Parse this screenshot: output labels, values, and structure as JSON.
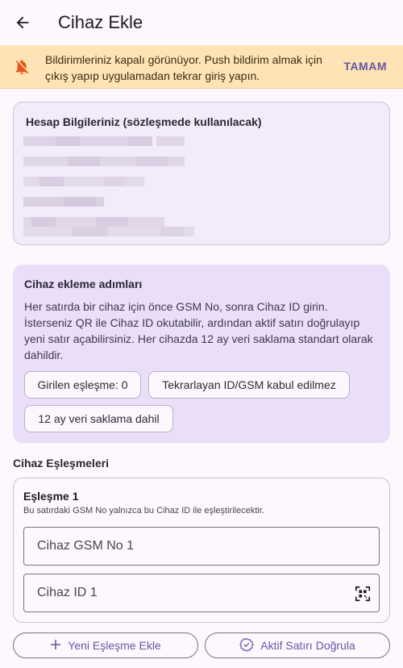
{
  "appbar": {
    "title": "Cihaz Ekle",
    "back_icon": "arrow-back-icon"
  },
  "banner": {
    "icon": "notifications-off-icon",
    "text": "Bildirimleriniz kapalı görünüyor. Push bildirim almak için çıkış yapıp uygulamadan tekrar giriş yapın.",
    "action_label": "TAMAM",
    "color_bg": "#fde3b5",
    "color_icon": "#e8541a"
  },
  "account_card": {
    "title": "Hesap Bilgileriniz (sözleşmede kullanılacak)"
  },
  "steps_card": {
    "title": "Cihaz ekleme adımları",
    "description": "Her satırda bir cihaz için önce GSM No, sonra Cihaz ID girin. İsterseniz QR ile Cihaz ID okutabilir, ardından aktif satırı doğrulayıp yeni satır açabilirsiniz. Her cihazda 12 ay veri saklama standart olarak dahildir.",
    "chips": [
      {
        "label": "Girilen eşleşme: 0"
      },
      {
        "label": "Tekrarlayan ID/GSM kabul edilmez"
      },
      {
        "label": "12 ay veri saklama dahil"
      }
    ]
  },
  "pairings": {
    "section_title": "Cihaz Eşleşmeleri",
    "items": [
      {
        "title": "Eşleşme 1",
        "subtitle": "Bu satırdaki GSM No yalnızca bu Cihaz ID ile eşleştirilecektir.",
        "gsm_placeholder": "Cihaz GSM No 1",
        "gsm_value": "",
        "id_placeholder": "Cihaz ID 1",
        "id_value": "",
        "qr_icon": "qr-scan-icon"
      }
    ]
  },
  "actions": {
    "add_label": "Yeni Eşleşme Ekle",
    "add_icon": "plus-icon",
    "verify_label": "Aktif Satırı Doğrula",
    "verify_icon": "verified-check-icon"
  },
  "colors": {
    "accent": "#6a55a3",
    "background": "#fdf8fd"
  }
}
